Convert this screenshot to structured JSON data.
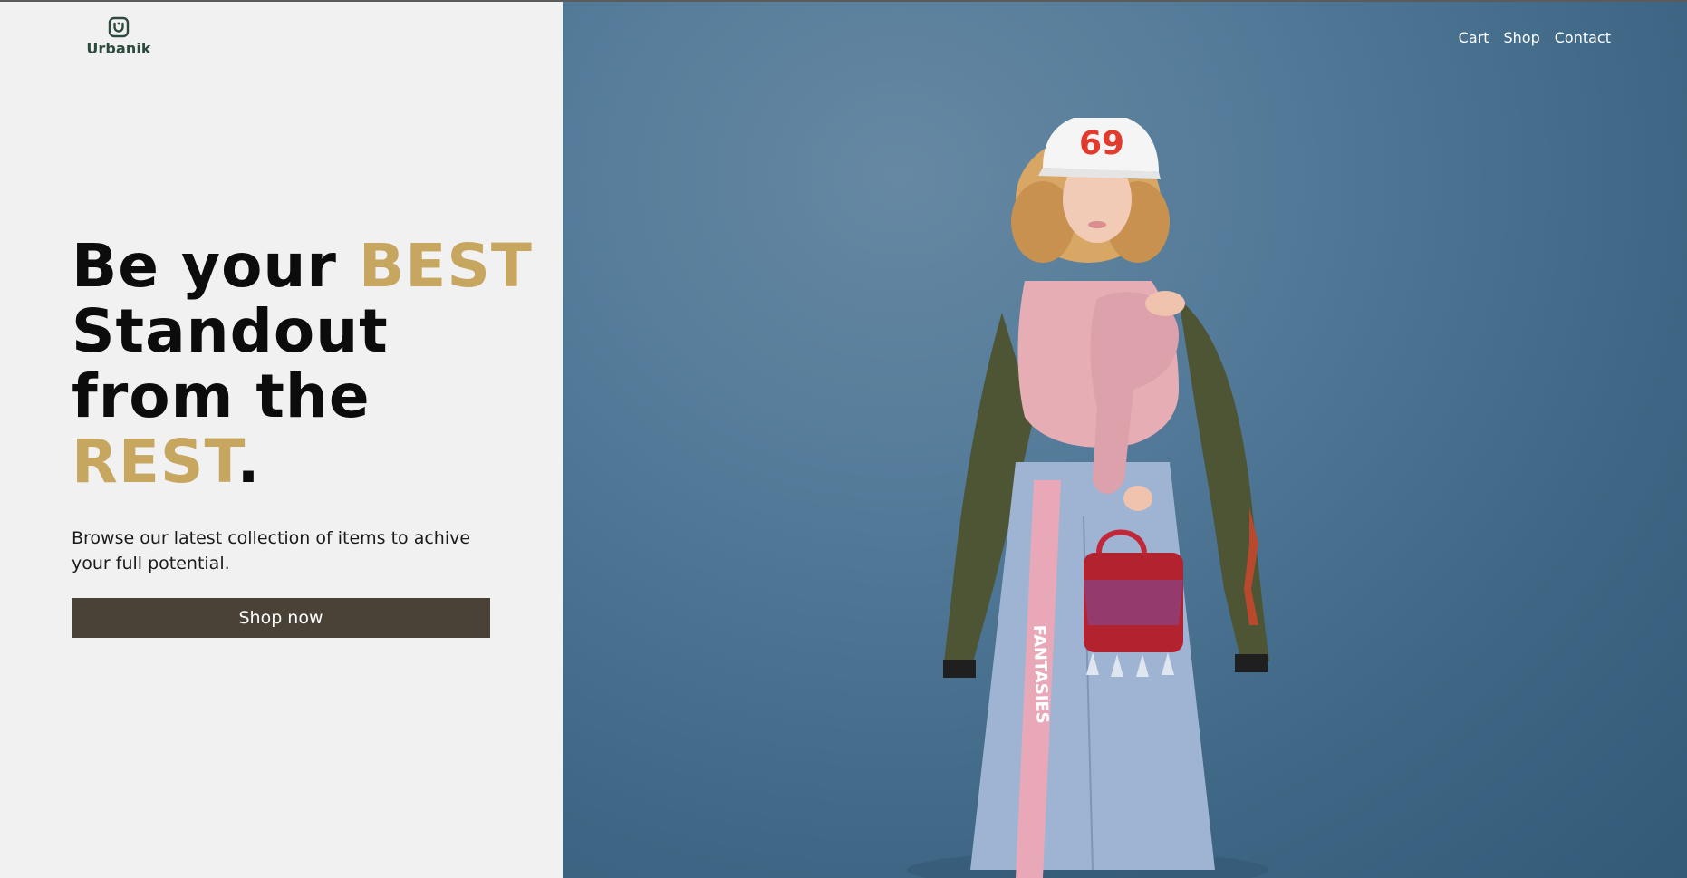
{
  "brand": {
    "name": "Urbanik",
    "logo_icon": "smile-box-icon",
    "color": "#2e4a3c"
  },
  "nav": {
    "items": [
      {
        "label": "Cart"
      },
      {
        "label": "Shop"
      },
      {
        "label": "Contact"
      }
    ]
  },
  "hero": {
    "title_part1": "Be your ",
    "title_accent1": "BEST",
    "title_part2": "Standout",
    "title_part3": "from the",
    "title_accent2": "REST",
    "title_end": ".",
    "description": "Browse our latest collection of items to achive your full potential.",
    "cta_label": "Shop now",
    "accent_color": "#c7a660",
    "button_color": "#4a4236"
  },
  "image": {
    "subject": "fashion-model-photo",
    "background_color": "#527a98",
    "cap_text": "69",
    "tape_text": "FANTASIES"
  }
}
